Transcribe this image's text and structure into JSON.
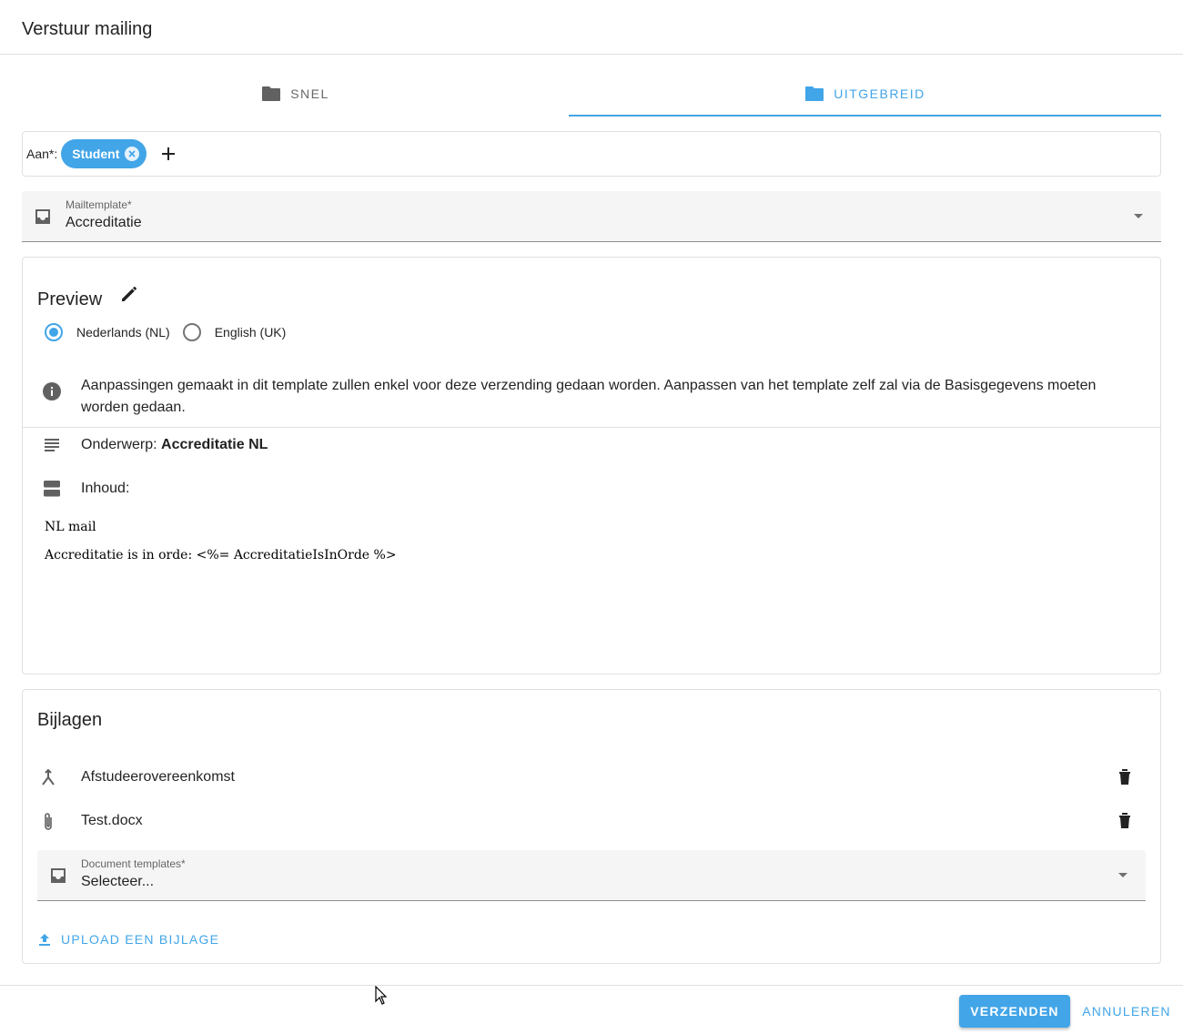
{
  "dialog": {
    "title": "Verstuur mailing"
  },
  "tabs": [
    {
      "label": "SNEL",
      "icon": "folder-icon",
      "active": false
    },
    {
      "label": "UITGEBREID",
      "icon": "folder-icon",
      "active": true
    }
  ],
  "recipients": {
    "label": "Aan*:",
    "chips": [
      "Student"
    ]
  },
  "mail_template": {
    "label": "Mailtemplate*",
    "value": "Accreditatie"
  },
  "preview": {
    "title": "Preview",
    "languages": [
      {
        "label": "Nederlands (NL)",
        "selected": true
      },
      {
        "label": "English (UK)",
        "selected": false
      }
    ],
    "info": "Aanpassingen gemaakt in dit template zullen enkel voor deze verzending gedaan worden. Aanpassen van het template zelf zal via de Basisgegevens moeten worden gedaan.",
    "subject_label": "Onderwerp:",
    "subject_value": "Accreditatie NL",
    "content_label": "Inhoud:",
    "body_lines": [
      "NL mail",
      "Accreditatie is in orde: <%= AccreditatieIsInOrde %>"
    ]
  },
  "attachments": {
    "title": "Bijlagen",
    "items": [
      {
        "name": "Afstudeerovereenkomst",
        "icon": "merge-icon"
      },
      {
        "name": "Test.docx",
        "icon": "paperclip-icon"
      }
    ],
    "document_templates": {
      "label": "Document templates*",
      "value": "Selecteer..."
    },
    "upload_label": "UPLOAD EEN BIJLAGE"
  },
  "actions": {
    "send": "VERZENDEN",
    "cancel": "ANNULEREN"
  },
  "colors": {
    "accent": "#42a5e8"
  }
}
